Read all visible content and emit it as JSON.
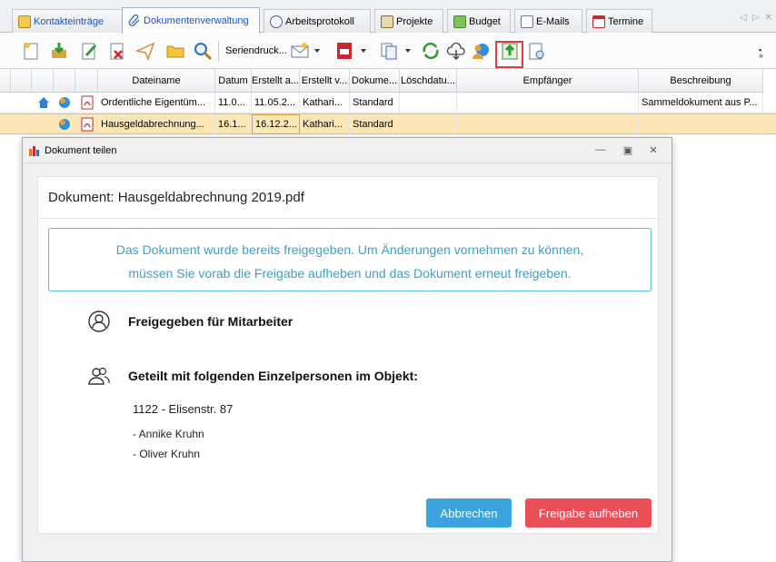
{
  "tabs": [
    {
      "label": "Kontakteinträge",
      "icon": "contacts-icon"
    },
    {
      "label": "Dokumentenverwaltung",
      "icon": "paperclip-icon"
    },
    {
      "label": "Arbeitsprotokoll",
      "icon": "clock-icon"
    },
    {
      "label": "Projekte",
      "icon": "projects-icon"
    },
    {
      "label": "Budget",
      "icon": "budget-icon"
    },
    {
      "label": "E-Mails",
      "icon": "mail-icon"
    },
    {
      "label": "Termine",
      "icon": "calendar-icon"
    }
  ],
  "toolbar": {
    "serial_print_label": "Seriendruck...",
    "highlight_color": "#e03c3c"
  },
  "grid": {
    "columns": [
      "Dateiname",
      "Datum",
      "Erstellt a...",
      "Erstellt v...",
      "Dokume...",
      "Löschdatu...",
      "Empfänger",
      "Beschreibung"
    ],
    "rows": [
      {
        "dateiname": "Ordentliche Eigentüm...",
        "datum": "11.0...",
        "erstellt_am": "11.05.2...",
        "erstellt_von": "Kathari...",
        "dokumenttyp": "Standard",
        "loeschdatum": "",
        "empfaenger": "",
        "beschreibung": "Sammeldokument aus P..."
      },
      {
        "dateiname": "Hausgeldabrechnung...",
        "datum": "16.1...",
        "erstellt_am": "16.12.2...",
        "erstellt_von": "Kathari...",
        "dokumenttyp": "Standard",
        "loeschdatum": "",
        "empfaenger": "",
        "beschreibung": ""
      }
    ]
  },
  "modal": {
    "title": "Dokument teilen",
    "document_heading": "Dokument: Hausgeldabrechnung 2019.pdf",
    "alert_line1": "Das Dokument wurde bereits freigegeben. Um Änderungen vornehmen zu können,",
    "alert_line2": "müssen Sie vorab die Freigabe aufheben und das Dokument erneut freigeben.",
    "employees_title": "Freigegeben für Mitarbeiter",
    "individuals_title": "Geteilt mit folgenden Einzelpersonen im Objekt:",
    "object_name": "1122 - Elisenstr. 87",
    "persons": [
      "- Annike Kruhn",
      "- Oliver Kruhn"
    ],
    "cancel_label": "Abbrechen",
    "release_label": "Freigabe aufheben"
  },
  "colors": {
    "cancel": "#3ba4dc",
    "release": "#ea4f57",
    "alert_text": "#3da0c7",
    "selected_row": "#fde7b7"
  }
}
